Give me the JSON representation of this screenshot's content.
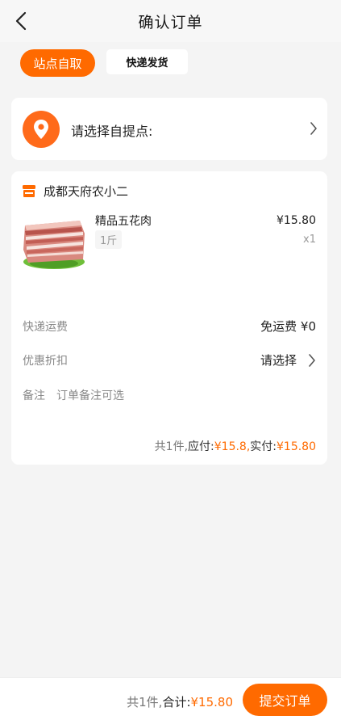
{
  "header": {
    "title": "确认订单"
  },
  "tabs": [
    {
      "label": "站点自取",
      "active": true
    },
    {
      "label": "快递发货",
      "active": false
    }
  ],
  "pickup": {
    "label": "请选择自提点:"
  },
  "shop": {
    "name": "成都天府农小二"
  },
  "product": {
    "name": "精品五花肉",
    "spec": "1斤",
    "price": "¥15.80",
    "qty": "x1"
  },
  "rows": {
    "shipping_label": "快递运费",
    "shipping_value": "免运费 ¥0",
    "discount_label": "优惠折扣",
    "discount_value": "请选择",
    "remark_label": "备注",
    "remark_placeholder": "订单备注可选"
  },
  "summary": {
    "count": "共1件,",
    "payable_label": "应付:",
    "payable_value": "¥15.8,",
    "actual_label": "实付:",
    "actual_value": "¥15.80"
  },
  "bottom": {
    "count": "共1件,",
    "total_label": "合计:",
    "total_value": "¥15.80",
    "submit_label": "提交订单"
  },
  "colors": {
    "accent": "#ff6a00",
    "background": "#f4f4f4"
  },
  "icons": [
    "back-arrow-icon",
    "location-pin-icon",
    "chevron-right-icon",
    "shop-icon"
  ]
}
